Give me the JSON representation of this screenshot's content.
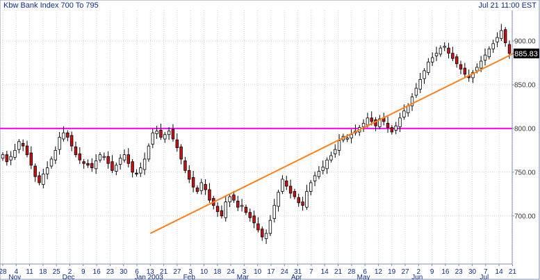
{
  "chart_data": {
    "type": "candlestick",
    "title": "Kbw Bank Index 700 To 795",
    "timestamp": "Jul 21 11:00 EST",
    "last_price": "885.83",
    "ylim": [
      645,
      935
    ],
    "yticks": [
      {
        "value": 700,
        "label": "700.00"
      },
      {
        "value": 750,
        "label": "750.00"
      },
      {
        "value": 800,
        "label": "800.00"
      },
      {
        "value": 850,
        "label": "850.00"
      },
      {
        "value": 900,
        "label": "900.00"
      }
    ],
    "day_labels": [
      "28",
      "4",
      "11",
      "18",
      "25",
      "2",
      "9",
      "16",
      "23",
      "30",
      "6",
      "13",
      "21",
      "27",
      "3",
      "10",
      "18",
      "24",
      "3",
      "10",
      "17",
      "24",
      "31",
      "7",
      "14",
      "21",
      "28",
      "6",
      "12",
      "19",
      "27",
      "2",
      "9",
      "16",
      "23",
      "30",
      "7",
      "14",
      "21"
    ],
    "month_labels": [
      "Nov",
      "Dec",
      "Jan 2003",
      "Feb",
      "Mar",
      "Apr",
      "May",
      "Jun",
      "Jul"
    ],
    "month_label_slots": [
      1,
      5,
      11,
      14,
      18,
      22,
      27,
      31,
      36
    ],
    "grid": true,
    "horizontal_line": {
      "value": 800,
      "color": "#ff00ff"
    },
    "trendline": {
      "from": [
        11,
        680
      ],
      "to": [
        38.5,
        889
      ],
      "color": "#ff7f1a"
    },
    "colors": {
      "up": "#ffffff",
      "down": "#cc1111",
      "outline": "#000000",
      "axis_text": "#0b2a8a",
      "grid": "#d0d0d0"
    },
    "series_close": [
      770,
      762,
      768,
      775,
      785,
      780,
      770,
      758,
      745,
      738,
      748,
      755,
      765,
      775,
      790,
      795,
      790,
      780,
      770,
      764,
      760,
      758,
      755,
      763,
      770,
      768,
      760,
      752,
      758,
      766,
      770,
      760,
      750,
      748,
      755,
      765,
      780,
      795,
      797,
      790,
      793,
      797,
      788,
      778,
      765,
      752,
      742,
      733,
      728,
      738,
      730,
      718,
      712,
      705,
      700,
      716,
      722,
      718,
      710,
      712,
      704,
      698,
      692,
      684,
      676,
      680,
      695,
      712,
      727,
      742,
      734,
      726,
      722,
      715,
      712,
      728,
      738,
      746,
      751,
      756,
      764,
      769,
      776,
      786,
      791,
      789,
      793,
      797,
      801,
      806,
      812,
      808,
      803,
      811,
      808,
      801,
      796,
      803,
      812,
      820,
      826,
      836,
      846,
      856,
      866,
      876,
      881,
      886,
      892,
      894,
      886,
      880,
      874,
      868,
      862,
      858,
      864,
      870,
      877,
      884,
      891,
      897,
      904,
      912,
      898,
      885.83
    ]
  }
}
